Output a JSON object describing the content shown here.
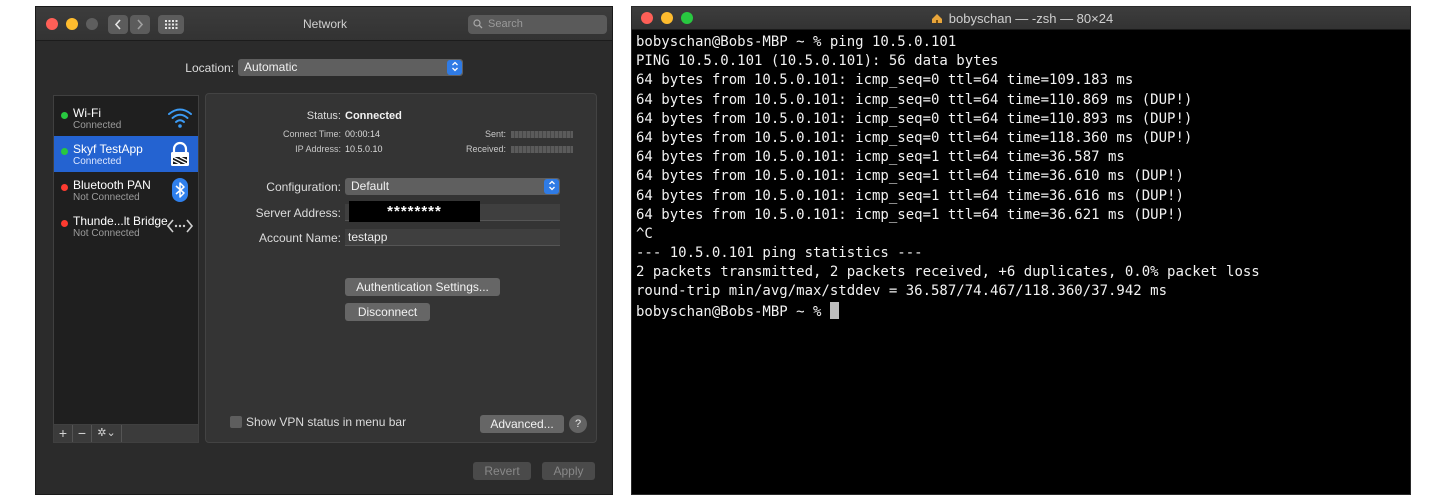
{
  "network": {
    "window_title": "Network",
    "search_placeholder": "Search",
    "location_label": "Location:",
    "location_value": "Automatic",
    "services": [
      {
        "name": "Wi-Fi",
        "status": "Connected",
        "dot": "#28c840",
        "icon": "wifi-icon"
      },
      {
        "name": "Skyf TestApp",
        "status": "Connected",
        "dot": "#28c840",
        "icon": "vpn-lock-icon"
      },
      {
        "name": "Bluetooth PAN",
        "status": "Not Connected",
        "dot": "#fe3b30",
        "icon": "bluetooth-icon"
      },
      {
        "name": "Thunde...lt Bridge",
        "status": "Not Connected",
        "dot": "#fe3b30",
        "icon": "thunderbolt-bridge-icon"
      }
    ],
    "detail": {
      "status_label": "Status:",
      "status_value": "Connected",
      "connect_time_label": "Connect Time:",
      "connect_time_value": "00:00:14",
      "ip_label": "IP Address:",
      "ip_value": "10.5.0.10",
      "sent_label": "Sent:",
      "received_label": "Received:",
      "configuration_label": "Configuration:",
      "configuration_value": "Default",
      "server_label": "Server Address:",
      "server_value": "********",
      "account_label": "Account Name:",
      "account_value": "testapp",
      "auth_button": "Authentication Settings...",
      "disconnect_button": "Disconnect",
      "show_vpn_label": "Show VPN status in menu bar",
      "advanced_button": "Advanced...",
      "help": "?"
    },
    "revert_button": "Revert",
    "apply_button": "Apply",
    "tools": {
      "add": "+",
      "remove": "−",
      "gear": "✲⌄"
    }
  },
  "terminal": {
    "title": "bobyschan — -zsh — 80×24",
    "lines": [
      "bobyschan@Bobs-MBP ~ % ping 10.5.0.101",
      "PING 10.5.0.101 (10.5.0.101): 56 data bytes",
      "64 bytes from 10.5.0.101: icmp_seq=0 ttl=64 time=109.183 ms",
      "64 bytes from 10.5.0.101: icmp_seq=0 ttl=64 time=110.869 ms (DUP!)",
      "64 bytes from 10.5.0.101: icmp_seq=0 ttl=64 time=110.893 ms (DUP!)",
      "64 bytes from 10.5.0.101: icmp_seq=0 ttl=64 time=118.360 ms (DUP!)",
      "64 bytes from 10.5.0.101: icmp_seq=1 ttl=64 time=36.587 ms",
      "64 bytes from 10.5.0.101: icmp_seq=1 ttl=64 time=36.610 ms (DUP!)",
      "64 bytes from 10.5.0.101: icmp_seq=1 ttl=64 time=36.616 ms (DUP!)",
      "64 bytes from 10.5.0.101: icmp_seq=1 ttl=64 time=36.621 ms (DUP!)",
      "^C",
      "--- 10.5.0.101 ping statistics ---",
      "2 packets transmitted, 2 packets received, +6 duplicates, 0.0% packet loss",
      "round-trip min/avg/max/stddev = 36.587/74.467/118.360/37.942 ms",
      "bobyschan@Bobs-MBP ~ % "
    ]
  }
}
